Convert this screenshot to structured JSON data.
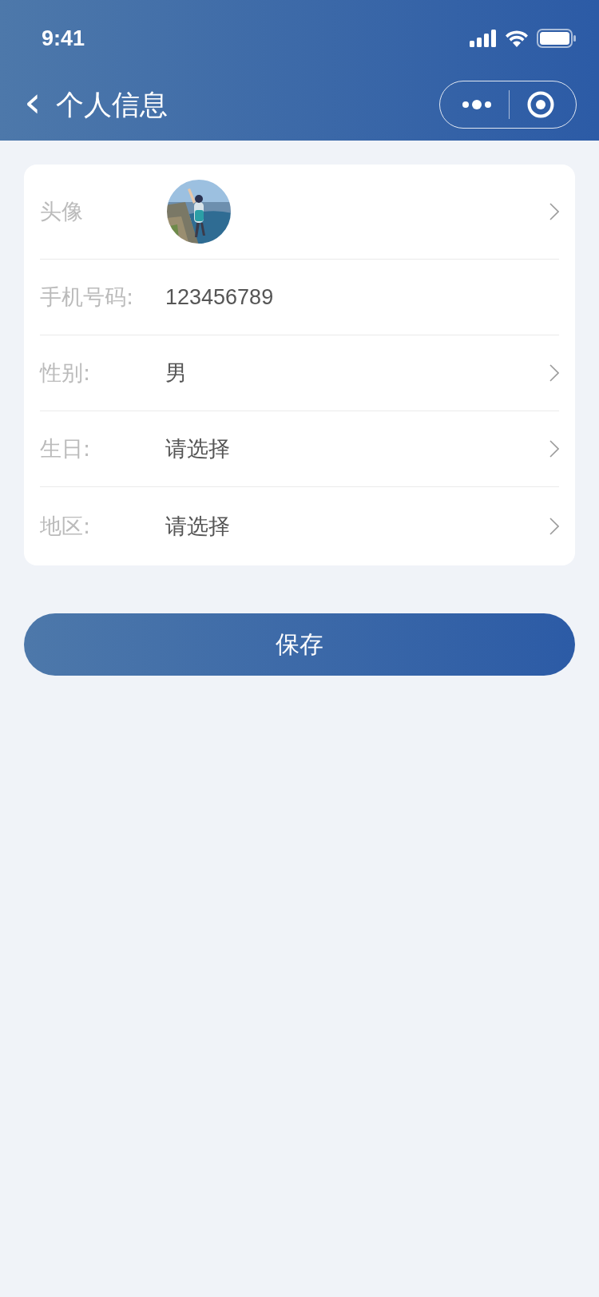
{
  "status_bar": {
    "time": "9:41"
  },
  "nav_bar": {
    "back_icon": "‹",
    "title": "个人信息"
  },
  "rows": [
    {
      "kind": "avatar",
      "label": "头像",
      "chevron": true
    },
    {
      "kind": "text",
      "label": "手机号码:",
      "value": "123456789",
      "chevron": false
    },
    {
      "kind": "text",
      "label": "性别:",
      "value": "男",
      "chevron": true
    },
    {
      "kind": "text",
      "label": "生日:",
      "value": "请选择",
      "chevron": true
    },
    {
      "kind": "text",
      "label": "地区:",
      "value": "请选择",
      "chevron": true
    }
  ],
  "save_button": {
    "label": "保存"
  }
}
